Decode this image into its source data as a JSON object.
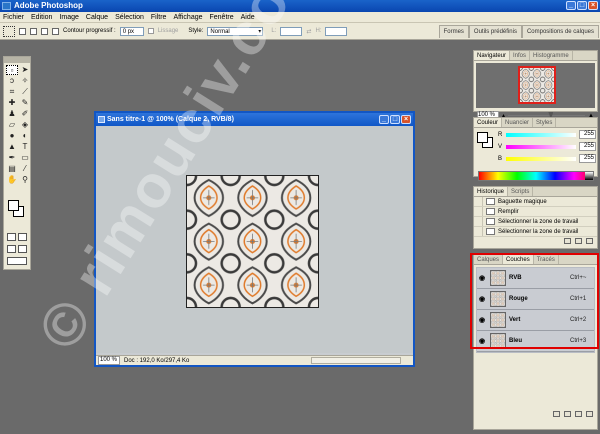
{
  "app": {
    "title": "Adobe Photoshop"
  },
  "menu": [
    "Fichier",
    "Edition",
    "Image",
    "Calque",
    "Sélection",
    "Filtre",
    "Affichage",
    "Fenêtre",
    "Aide"
  ],
  "options": {
    "feather_label": "Contour progressif :",
    "feather_value": "0 px",
    "lisse_label": "Lissage",
    "style_label": "Style:",
    "style_value": "Normal",
    "l_label": "L:",
    "h_label": "H:"
  },
  "well_tabs": [
    "Formes",
    "Outils prédéfinis",
    "Compositions de calques"
  ],
  "document": {
    "title": "Sans titre-1 @ 100% (Calque 2, RVB/8)",
    "zoom": "100 %",
    "doc_info": "Doc : 192,0 Ko/297,4 Ko"
  },
  "navigator": {
    "tabs": [
      "Navigateur",
      "Infos",
      "Histogramme"
    ],
    "zoom": "100 %",
    "zoom_level": 0.55
  },
  "color_panel": {
    "tabs": [
      "Couleur",
      "Nuancier",
      "Styles"
    ],
    "rows": [
      {
        "label": "R",
        "value": "255",
        "gradient": "#00ffff"
      },
      {
        "label": "V",
        "value": "255",
        "gradient": "#ff00ff"
      },
      {
        "label": "B",
        "value": "255",
        "gradient": "#ffff00"
      }
    ]
  },
  "history": {
    "tabs": [
      "Historique",
      "Scripts"
    ],
    "items": [
      "Baguette magique",
      "Remplir",
      "Sélectionner la zone de travail",
      "Sélectionner la zone de travail"
    ]
  },
  "layers": {
    "tabs": [
      "Calques",
      "Couches",
      "Tracés"
    ],
    "channels": [
      {
        "name": "RVB",
        "shortcut": "Ctrl+~"
      },
      {
        "name": "Rouge",
        "shortcut": "Ctrl+1"
      },
      {
        "name": "Vert",
        "shortcut": "Ctrl+2"
      },
      {
        "name": "Bleu",
        "shortcut": "Ctrl+3"
      }
    ]
  },
  "watermark": "© rimouciv.com",
  "colors": {
    "titlebar": "#0a46b0",
    "highlight": "#e00000",
    "workspace": "#6a6a6a"
  }
}
